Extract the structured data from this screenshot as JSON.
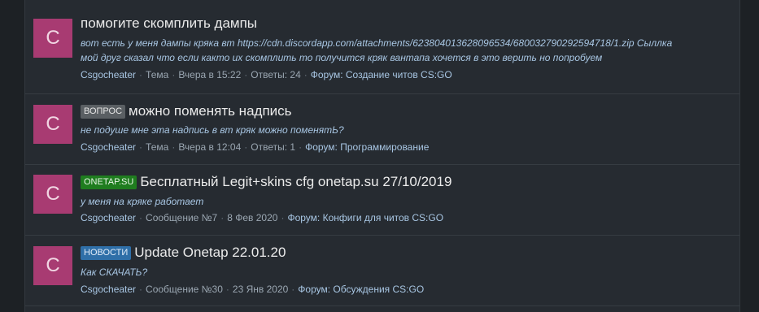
{
  "results": [
    {
      "avatar_letter": "C",
      "avatar_color": "#a83b72",
      "prefix": null,
      "title": "помогите скомплить дампы",
      "snippet_lines": [
        "вот есть у меня дампы кряка вт https://cdn.discordapp.com/attachments/623804013628096534/680032790292594718/1.zip Сыллка",
        "мой друг сказал что если както их скомплить то получится кряк вантапа хочется в это верить но попробуем"
      ],
      "author": "Csgocheater",
      "type": "Тема",
      "date": "Вчера в 15:22",
      "answers": "Ответы: 24",
      "forum": "Форум: Создание читов CS:GO"
    },
    {
      "avatar_letter": "C",
      "avatar_color": "#a83b72",
      "prefix": {
        "label": "ВОПРОС",
        "bg": "#5a5f63",
        "fg": "#e6e6e6"
      },
      "title": "можно поменять надпись",
      "snippet_lines": [
        "не подуше мне эта надпись в вт кряк можно поменятЬ?"
      ],
      "author": "Csgocheater",
      "type": "Тема",
      "date": "Вчера в 12:04",
      "answers": "Ответы: 1",
      "forum": "Форум: Программирование"
    },
    {
      "avatar_letter": "C",
      "avatar_color": "#a83b72",
      "prefix": {
        "label": "ONETAP.SU",
        "bg": "#1f7d1f",
        "fg": "#e8f5e8"
      },
      "title": "Бесплатный Legit+skins cfg onetap.su 27/10/2019",
      "snippet_lines": [
        "у меня на кряке работает"
      ],
      "author": "Csgocheater",
      "type": "Сообщение №7",
      "date": "8 Фев 2020",
      "answers": null,
      "forum": "Форум: Конфиги для читов CS:GO"
    },
    {
      "avatar_letter": "C",
      "avatar_color": "#a83b72",
      "prefix": {
        "label": "НОВОСТИ",
        "bg": "#2f6fa8",
        "fg": "#e3eefa"
      },
      "title": "Update Onetap 22.01.20",
      "snippet_lines": [
        "Как СКАЧАТЬ?"
      ],
      "author": "Csgocheater",
      "type": "Сообщение №30",
      "date": "23 Янв 2020",
      "answers": null,
      "forum": "Форум: Обсуждения CS:GO"
    }
  ]
}
